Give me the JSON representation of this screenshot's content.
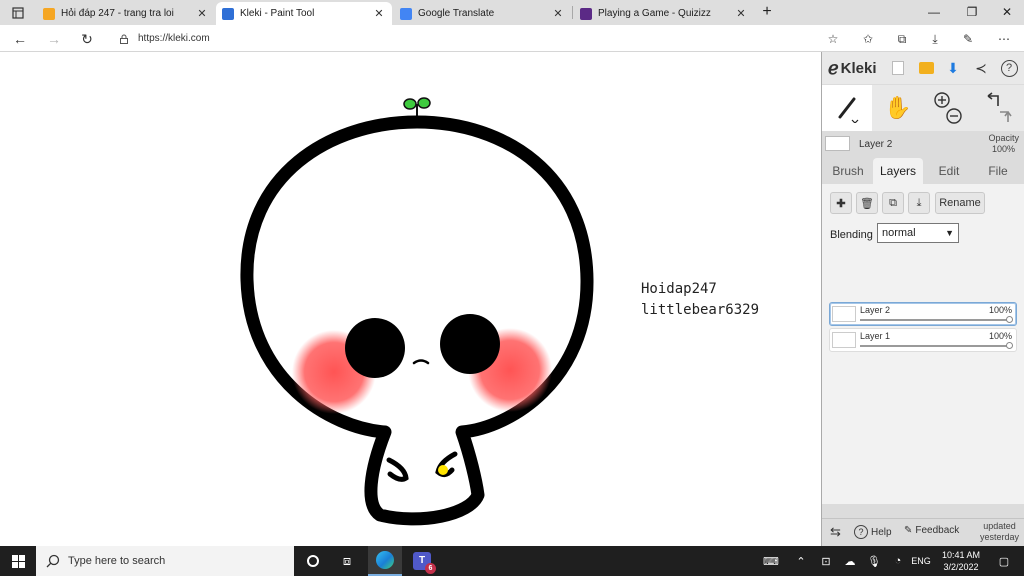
{
  "browser": {
    "tabs": [
      {
        "title": "Hỏi đáp 247 - trang tra loi",
        "favicon_color": "#f5a623"
      },
      {
        "title": "Kleki - Paint Tool",
        "favicon_color": "#2f6fd6"
      },
      {
        "title": "Google Translate",
        "favicon_color": "#4285f4"
      },
      {
        "title": "Playing a Game - Quizizz",
        "favicon_color": "#5b2a86"
      }
    ],
    "active_tab": 1,
    "url": "https://kleki.com"
  },
  "canvas": {
    "watermark_line1": "Hoidap247",
    "watermark_line2": "littlebear6329",
    "blush_color": "#ff5a5a",
    "sprout_color": "#3ecb3e"
  },
  "kleki": {
    "brand": "Kleki",
    "current_layer": "Layer 2",
    "opacity_label": "Opacity",
    "opacity_value": "100%",
    "tabs": [
      "Brush",
      "Layers",
      "Edit",
      "File"
    ],
    "active_tab": "Layers",
    "rename_label": "Rename",
    "blending_label": "Blending",
    "blending_value": "normal",
    "layers": [
      {
        "name": "Layer 2",
        "opacity": "100%",
        "selected": true
      },
      {
        "name": "Layer 1",
        "opacity": "100%",
        "selected": false
      }
    ],
    "help_label": "Help",
    "feedback_label": "Feedback",
    "updated_line1": "updated",
    "updated_line2": "yesterday"
  },
  "taskbar": {
    "search_placeholder": "Type here to search",
    "teams_badge": "6",
    "language": "ENG",
    "time": "10:41 AM",
    "date": "3/2/2022"
  }
}
